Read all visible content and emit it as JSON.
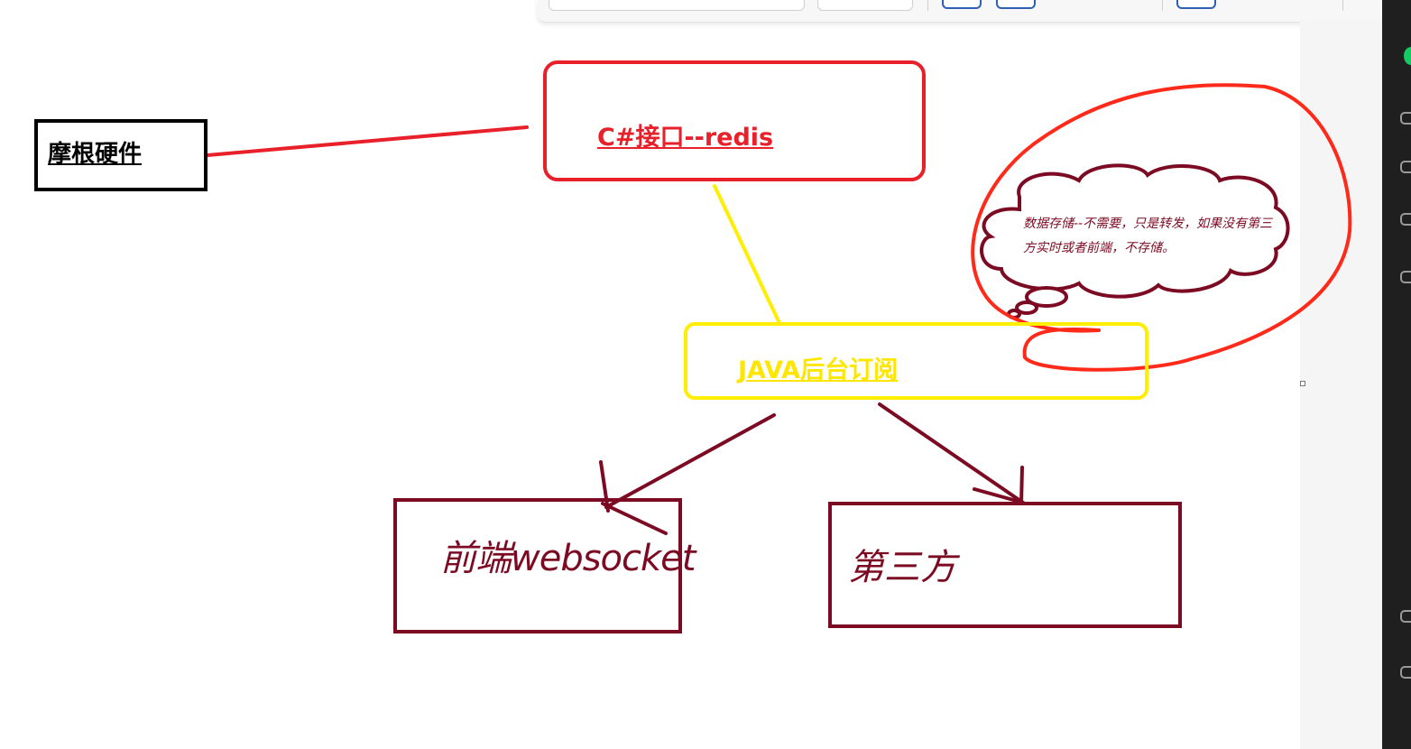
{
  "diagram": {
    "nodes": {
      "hardware": {
        "label": "摩根硬件"
      },
      "redis": {
        "label": "C#接口--redis"
      },
      "java": {
        "label": "JAVA后台订阅"
      },
      "frontend": {
        "label": "前端websocket"
      },
      "third_party": {
        "label": "第三方"
      }
    },
    "callout": {
      "text": "数据存储--不需要，只是转发，如果没有第三方实时或者前端，不存储。"
    },
    "edges": [
      {
        "from": "hardware",
        "to": "redis",
        "color": "#e8202a"
      },
      {
        "from": "redis",
        "to": "java",
        "color": "#ffee00"
      },
      {
        "from": "java",
        "to": "frontend",
        "color": "#7b0a22",
        "arrow": true
      },
      {
        "from": "java",
        "to": "third_party",
        "color": "#7b0a22",
        "arrow": true
      }
    ]
  },
  "colors": {
    "red": "#e8202a",
    "yellow": "#ffee00",
    "maroon": "#7b0a22",
    "black": "#000000"
  }
}
